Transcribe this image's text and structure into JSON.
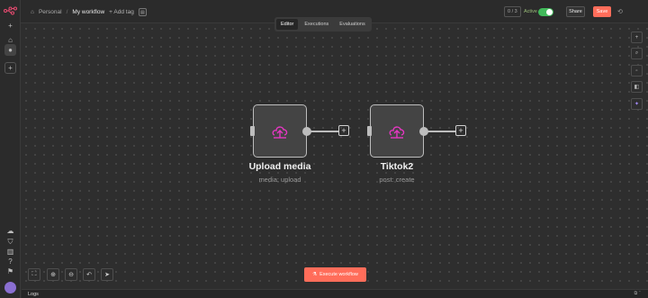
{
  "header": {
    "project": "Personal",
    "separator": "/",
    "workflow_name": "My workflow",
    "add_tag": "+ Add tag",
    "counter": "0 / 3",
    "active_label": "Active",
    "share_label": "Share",
    "save_label": "Save"
  },
  "tabs": [
    {
      "label": "Editor",
      "active": true
    },
    {
      "label": "Executions",
      "active": false
    },
    {
      "label": "Evaluations",
      "active": false
    }
  ],
  "nodes": [
    {
      "title": "Upload media",
      "subtitle": "media: upload",
      "icon": "tiktok-upload-icon"
    },
    {
      "title": "Tiktok2",
      "subtitle": "post: create",
      "icon": "tiktok-upload-icon"
    }
  ],
  "execute_label": "Execute workflow",
  "logs_label": "Logs",
  "colors": {
    "accent": "#ff6d5a",
    "toggle_on": "#41b95a",
    "node_icon": "#e637c3",
    "background": "#2e2e2e"
  }
}
